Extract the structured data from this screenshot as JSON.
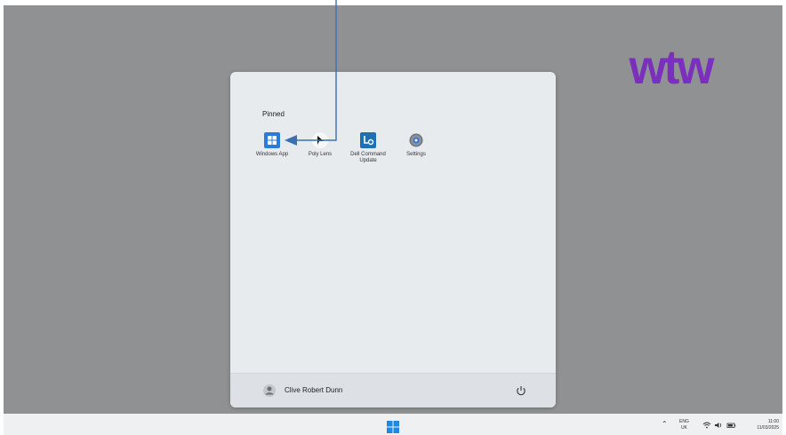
{
  "brand": {
    "logo_text": "wtw",
    "logo_color": "#7b2fbf"
  },
  "start_menu": {
    "pinned_label": "Pinned",
    "apps": [
      {
        "label": "Windows App",
        "icon": "windows-app-icon"
      },
      {
        "label": "Poly Lens",
        "icon": "poly-lens-icon"
      },
      {
        "label": "Dell Command Update",
        "icon": "dell-command-update-icon"
      },
      {
        "label": "Settings",
        "icon": "settings-gear-icon"
      }
    ],
    "user_name": "Clive Robert Dunn"
  },
  "taskbar": {
    "lang_line1": "ENG",
    "lang_line2": "UK",
    "time": "11:00",
    "date": "11/03/2025"
  },
  "colors": {
    "desktop": "#8f9193",
    "accent_blue": "#2f6fbf",
    "annotation_arrow": "#3a6fb5"
  }
}
